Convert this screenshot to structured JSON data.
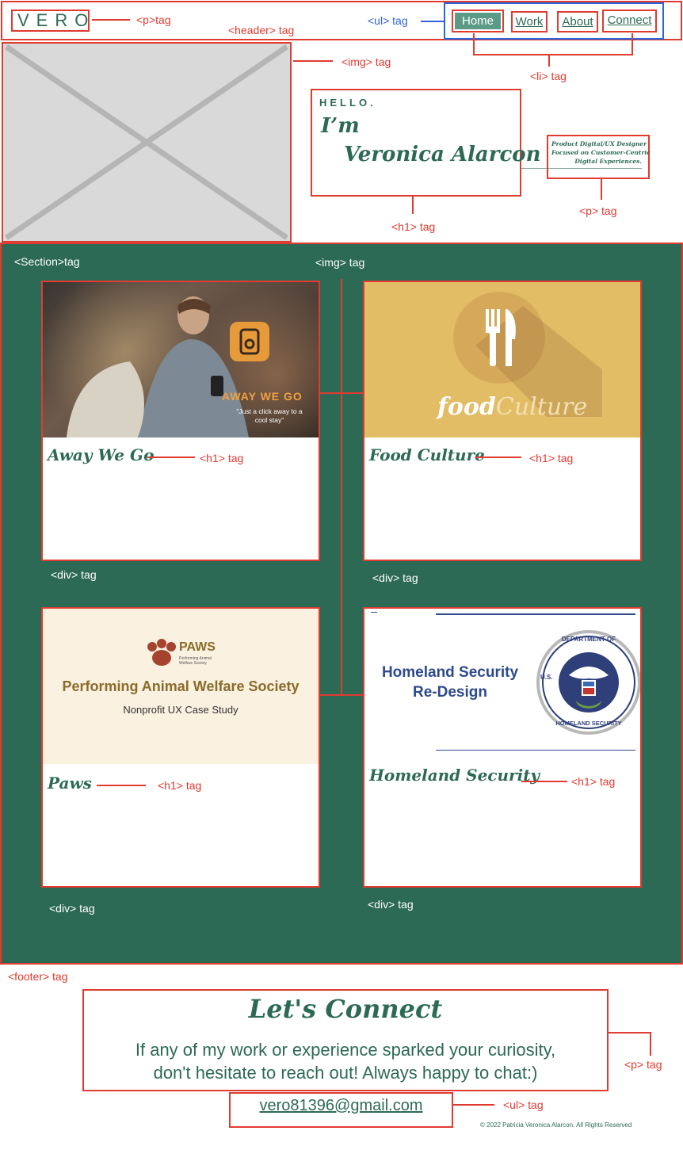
{
  "header": {
    "logo": "VERO",
    "nav": [
      {
        "label": "Home",
        "active": true
      },
      {
        "label": "Work",
        "active": false
      },
      {
        "label": "About",
        "active": false
      },
      {
        "label": "Connect",
        "active": false
      }
    ]
  },
  "hero": {
    "greeting": "HELLO.",
    "im": "I’m",
    "name": "Veronica Alarcon",
    "tagline_1": "Product Digital/UX Designer",
    "tagline_2": "Focused on Customer-Centric",
    "tagline_3": "Digital Experiences."
  },
  "cards": [
    {
      "title": "Away We Go",
      "image_heading": "AWAY WE GO",
      "image_caption_1": "\"Just a click away to a",
      "image_caption_2": "cool stay\""
    },
    {
      "title": "Food Culture",
      "image_logo_1": "food",
      "image_logo_2": "Culture"
    },
    {
      "title": "Paws",
      "image_brand": "PAWS",
      "image_brand_sub_1": "Performing Animal",
      "image_brand_sub_2": "Welfare Society",
      "image_heading": "Performing Animal Welfare Society",
      "image_subheading": "Nonprofit UX Case Study"
    },
    {
      "title": "Homeland Security",
      "image_heading_1": "Homeland Security",
      "image_heading_2": "Re-Design",
      "seal_top": "DEPARTMENT OF",
      "seal_bottom": "HOMELAND SECURITY",
      "seal_left": "U.S."
    }
  ],
  "footer": {
    "heading": "Let's Connect",
    "text_1": "If any of my work or experience sparked your curiosity,",
    "text_2": "don't hesitate to reach out! Always happy to chat:)",
    "email": "vero81396@gmail.com",
    "copyright": "© 2022 Patricia Veronica Alarcon. All Rights Reserved"
  },
  "annotations": {
    "p_tag": "<p>tag",
    "header_tag": "<header> tag",
    "ul_tag": "<ul> tag",
    "img_tag": "<img> tag",
    "li_tag": "<li> tag",
    "h1_tag": "<h1> tag",
    "p_tag2": "<p> tag",
    "section_tag": "<Section>tag",
    "div_tag": "<div> tag",
    "footer_tag": "<footer> tag"
  },
  "colors": {
    "brand_green": "#2d6a56",
    "annotation_red": "#e03b30",
    "annotation_blue": "#2f63d8",
    "nav_active_bg": "#5b9a86"
  }
}
